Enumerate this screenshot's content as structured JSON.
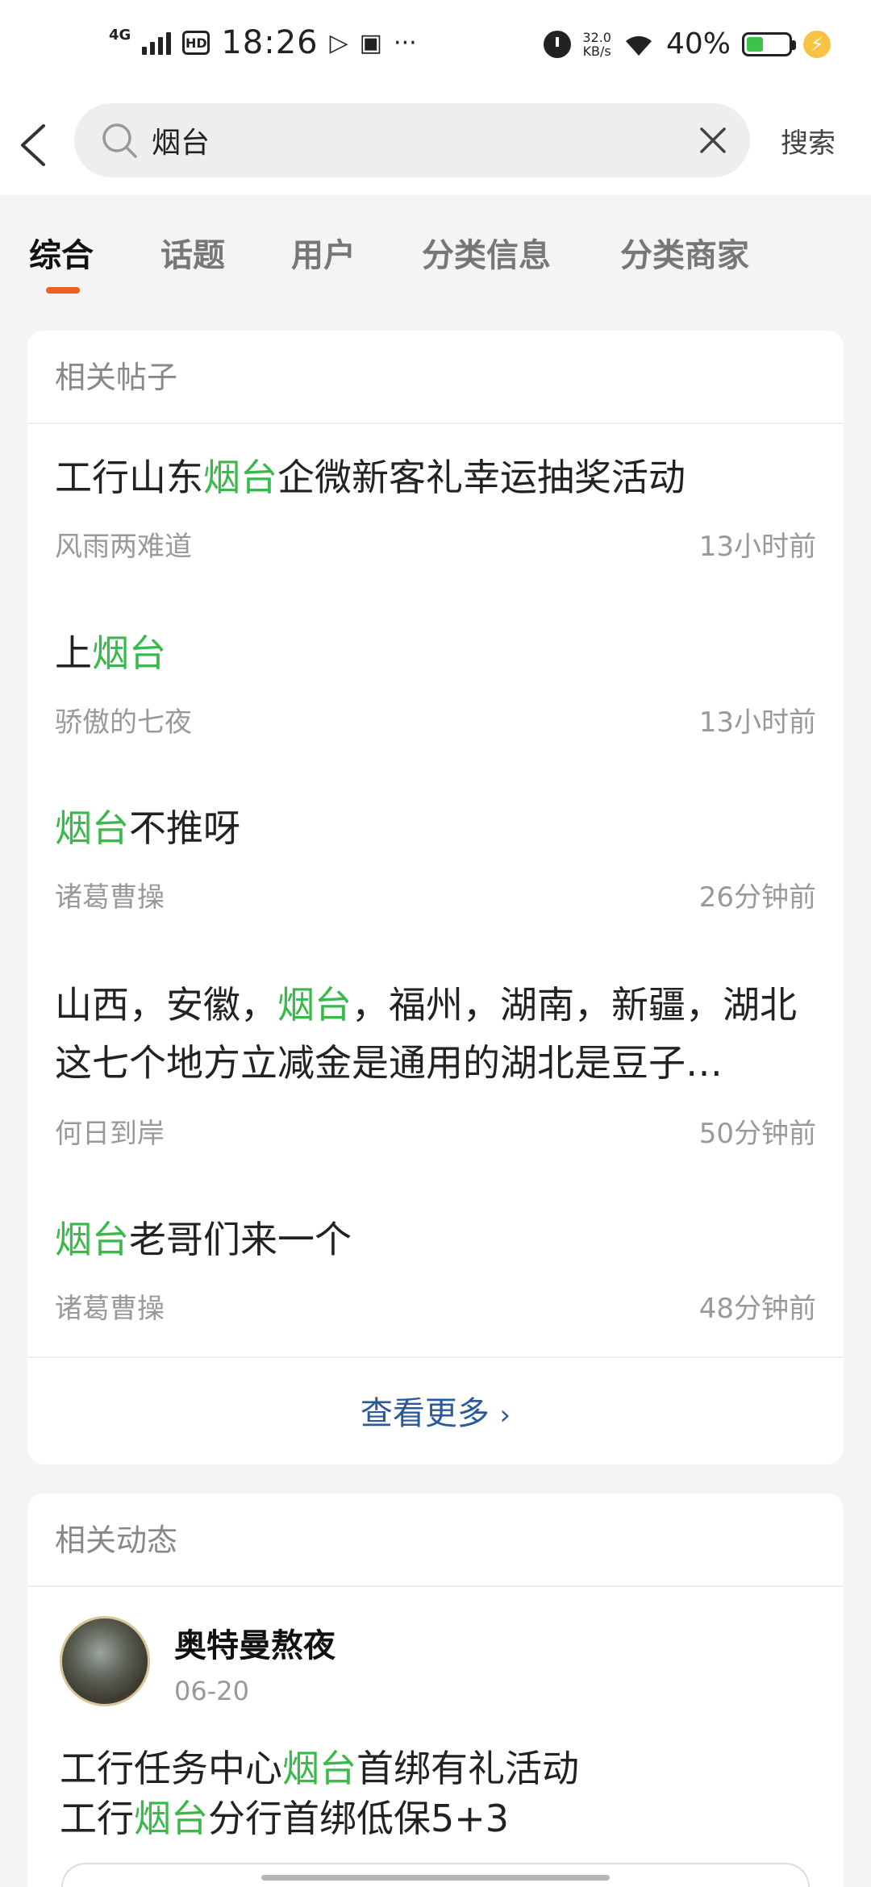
{
  "status_bar": {
    "network": "4G",
    "hd": "HD",
    "time": "18:26",
    "extra": "···",
    "speed_value": "32.0",
    "speed_unit": "KB/s",
    "battery_pct": "40%",
    "battery_level": 0.4
  },
  "search": {
    "query": "烟台",
    "button_label": "搜索"
  },
  "tabs": [
    {
      "label": "综合",
      "active": true
    },
    {
      "label": "话题",
      "active": false
    },
    {
      "label": "用户",
      "active": false
    },
    {
      "label": "分类信息",
      "active": false
    },
    {
      "label": "分类商家",
      "active": false
    }
  ],
  "related_posts": {
    "title": "相关帖子",
    "posts": [
      {
        "title_pre": "工行山东",
        "title_hl": "烟台",
        "title_post": "企微新客礼幸运抽奖活动",
        "author": "风雨两难道",
        "time": "13小时前"
      },
      {
        "title_pre": "上",
        "title_hl": "烟台",
        "title_post": "",
        "author": "骄傲的七夜",
        "time": "13小时前"
      },
      {
        "title_pre": "",
        "title_hl": "烟台",
        "title_post": "不推呀",
        "author": "诸葛曹操",
        "time": "26分钟前"
      },
      {
        "title_pre": "山西，安徽，",
        "title_hl": "烟台",
        "title_post": "，福州，湖南，新疆，湖北这七个地方立减金是通用的湖北是豆子…",
        "author": "何日到岸",
        "time": "50分钟前"
      },
      {
        "title_pre": "",
        "title_hl": "烟台",
        "title_post": "老哥们来一个",
        "author": "诸葛曹操",
        "time": "48分钟前"
      }
    ],
    "more_label": "查看更多"
  },
  "related_dynamics": {
    "title": "相关动态",
    "item": {
      "username": "奥特曼熬夜",
      "date": "06-20",
      "line1_pre": "工行任务中心",
      "line1_hl": "烟台",
      "line1_post": "首绑有礼活动",
      "line2_pre": "工行",
      "line2_hl": "烟台",
      "line2_post": "分行首绑低保5+3"
    }
  },
  "colors": {
    "highlight": "#3ab94b",
    "tab_indicator": "#f06023",
    "more_link": "#2a5a9c"
  }
}
